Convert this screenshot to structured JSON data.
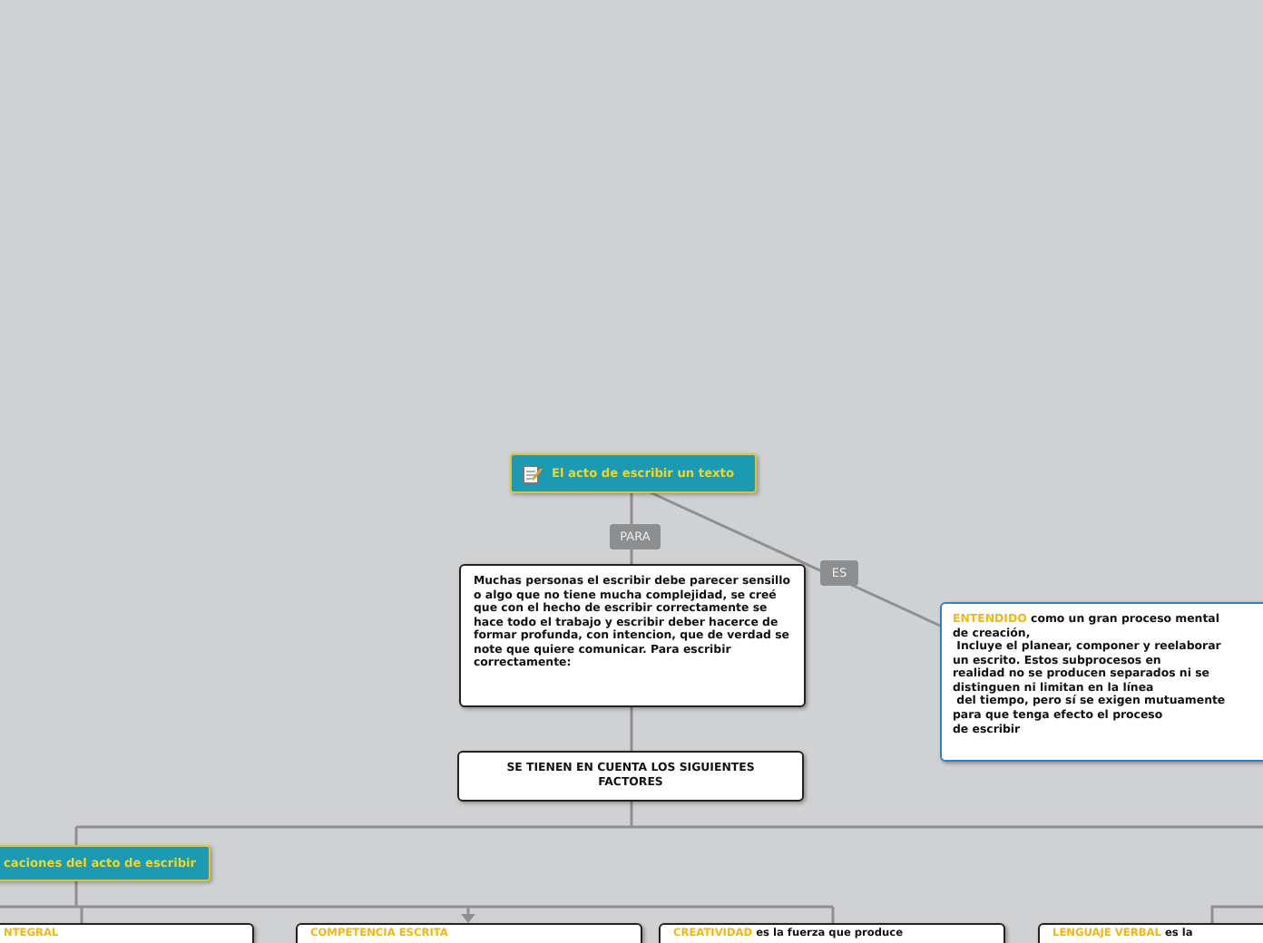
{
  "root": {
    "title": "El acto de escribir un texto"
  },
  "links": [
    {
      "label": "PARA"
    },
    {
      "label": "ES"
    }
  ],
  "intro_card": {
    "text": "Muchas personas el escribir debe parecer sensillo o algo que no tiene mucha complejidad, se creé que con el hecho de escribir correctamente se hace todo el trabajo y escribir deber hacerce de formar profunda, con intencion, que de verdad se note que quiere comunicar. Para escribir correctamente:"
  },
  "definition_card": {
    "highlight": "ENTENDIDO",
    "lines": [
      " como un gran proceso mental",
      "de creación,",
      " Incluye el planear, componer y reelaborar",
      "un escrito. Estos subprocesos en",
      "realidad no se producen separados ni se",
      "distinguen ni limitan en la línea",
      " del tiempo, pero sí se exigen mutuamente",
      "para que tenga efecto el proceso",
      "de escribir"
    ]
  },
  "factors_card": {
    "text": "SE TIENEN EN CUENTA LOS SIGUIENTES FACTORES"
  },
  "topic": {
    "title": "caciones del acto de escribir"
  },
  "bottom_cards": [
    {
      "highlight": "NTEGRAL"
    },
    {
      "highlight": "COMPETENCIA ESCRITA"
    },
    {
      "highlight": "CREATIVIDAD",
      "text": " es la fuerza que produce"
    },
    {
      "highlight": "LENGUAJE VERBAL",
      "text": " es la"
    }
  ]
}
